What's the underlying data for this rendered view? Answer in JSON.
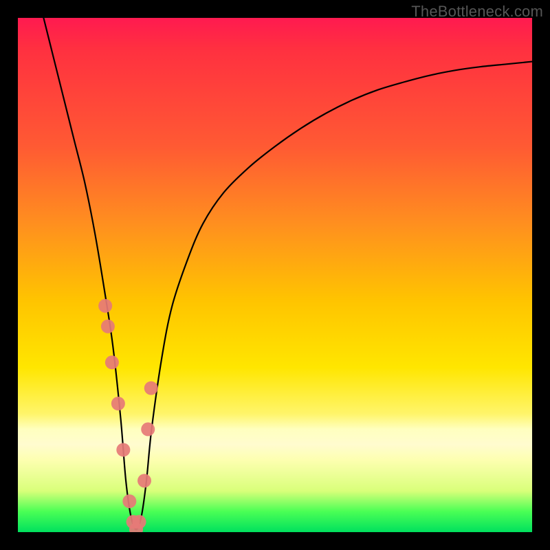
{
  "watermark": "TheBottleneck.com",
  "chart_data": {
    "type": "line",
    "title": "",
    "xlabel": "",
    "ylabel": "",
    "ylim": [
      0,
      100
    ],
    "xlim": [
      0,
      100
    ],
    "series": [
      {
        "name": "bottleneck-curve",
        "x": [
          5,
          7,
          9,
          11,
          13,
          15,
          17,
          18.5,
          20,
          21,
          22,
          23,
          24,
          25,
          26,
          28,
          30,
          33,
          36,
          40,
          45,
          50,
          55,
          60,
          65,
          70,
          75,
          80,
          85,
          90,
          95,
          100
        ],
        "y": [
          100,
          92,
          84,
          76,
          68,
          58,
          46,
          36,
          22,
          10,
          3,
          0.5,
          3,
          10,
          20,
          34,
          44,
          53,
          60,
          66,
          71,
          75,
          78.5,
          81.5,
          84,
          86,
          87.5,
          88.8,
          89.8,
          90.5,
          91,
          91.5
        ]
      }
    ],
    "markers": {
      "name": "highlight-points",
      "color": "#e67a77",
      "x": [
        17,
        17.5,
        18.3,
        19.5,
        20.5,
        21.7,
        22.4,
        23,
        23.6,
        24.6,
        25.3,
        25.9
      ],
      "y": [
        44,
        40,
        33,
        25,
        16,
        6,
        2,
        0.5,
        2,
        10,
        20,
        28
      ]
    },
    "gradient_bands": {
      "description": "vertical bottleneck severity gradient",
      "stops": [
        {
          "pos": 0.0,
          "color": "#ff1a50"
        },
        {
          "pos": 0.55,
          "color": "#ffc400"
        },
        {
          "pos": 0.83,
          "color": "#fffccf"
        },
        {
          "pos": 1.0,
          "color": "#00e05e"
        }
      ]
    }
  }
}
